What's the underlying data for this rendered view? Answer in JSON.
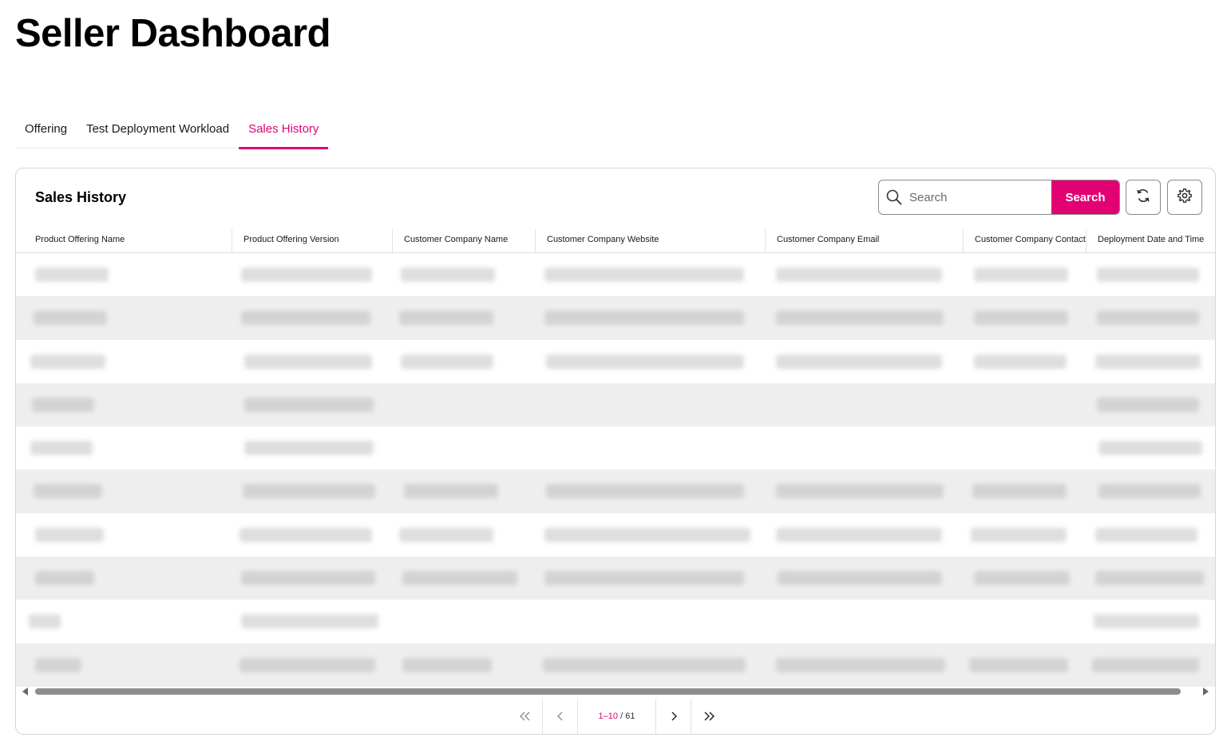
{
  "page": {
    "title": "Seller Dashboard"
  },
  "tabs": [
    {
      "label": "Offering",
      "active": false
    },
    {
      "label": "Test Deployment Workload",
      "active": false
    },
    {
      "label": "Sales History",
      "active": true
    }
  ],
  "card": {
    "title": "Sales History",
    "search": {
      "placeholder": "Search",
      "value": "",
      "button_label": "Search"
    },
    "refresh_icon": "refresh-icon",
    "settings_icon": "gear-icon"
  },
  "table": {
    "columns": [
      "Product Offering Name",
      "Product Offering Version",
      "Customer Company Name",
      "Customer Company Website",
      "Customer Company Email",
      "Customer Company Contact",
      "Deployment Date and Time"
    ],
    "row_count_visible": 10,
    "cells_redacted": true
  },
  "pagination": {
    "range": "1–10",
    "separator": " / ",
    "total": "61"
  },
  "colors": {
    "accent": "#e20074",
    "row_alt": "#eeeeee"
  }
}
